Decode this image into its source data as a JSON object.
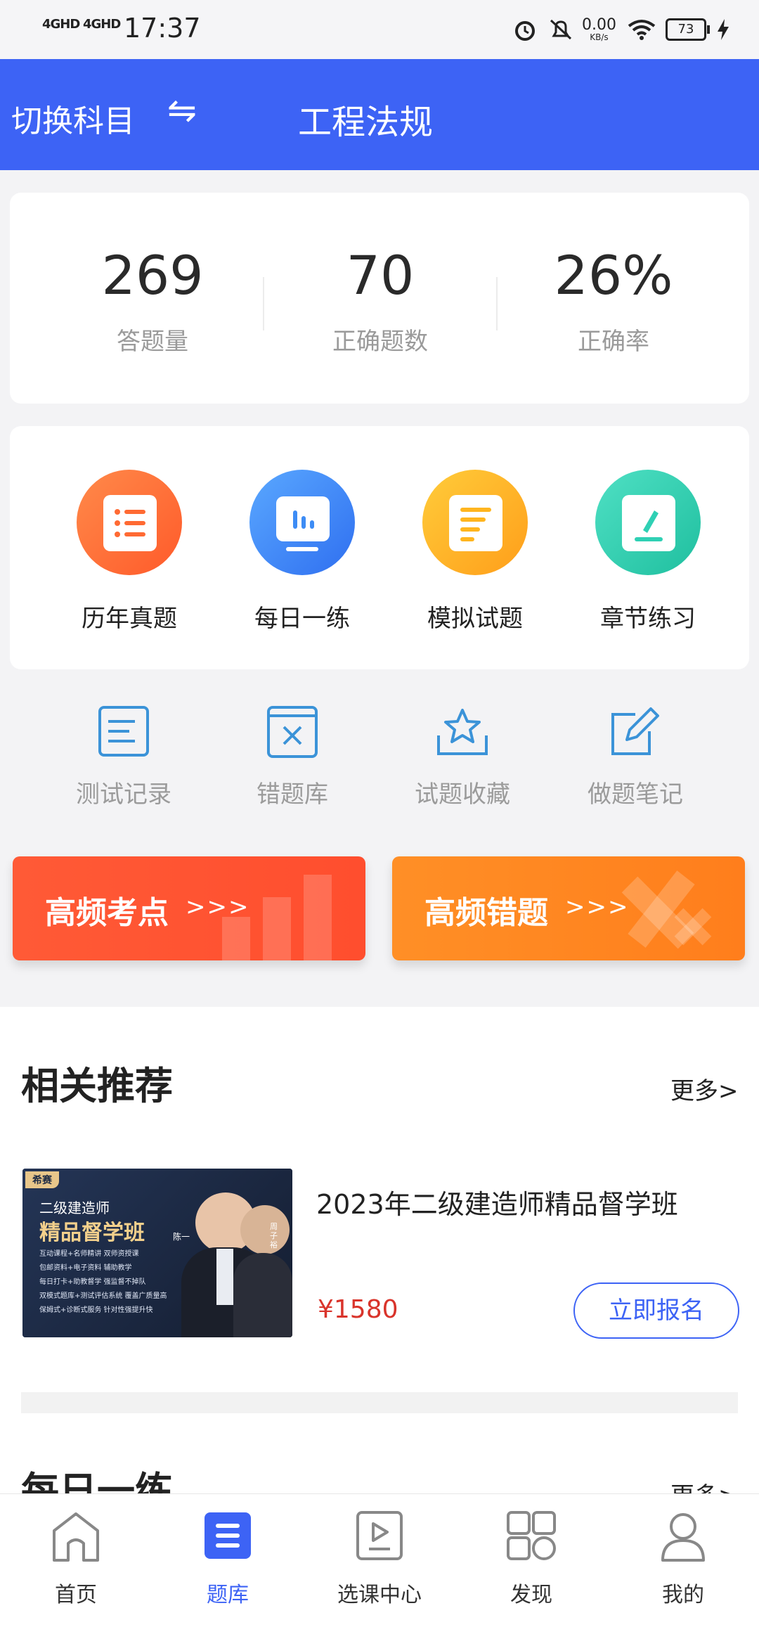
{
  "status_bar": {
    "signal1": "4GHD",
    "signal2": "4GHD",
    "time": "17:37",
    "net_speed": "0.00",
    "net_unit": "KB/s",
    "battery": "73"
  },
  "header": {
    "switch_label": "切换科目",
    "swap_icon": "⇋",
    "title": "工程法规"
  },
  "stats": [
    {
      "value": "269",
      "label": "答题量"
    },
    {
      "value": "70",
      "label": "正确题数"
    },
    {
      "value": "26%",
      "label": "正确率"
    }
  ],
  "features": [
    {
      "label": "历年真题",
      "icon": "list-icon",
      "color": "#ff6a33"
    },
    {
      "label": "每日一练",
      "icon": "chart-board-icon",
      "color": "#3d8cf5"
    },
    {
      "label": "模拟试题",
      "icon": "document-icon",
      "color": "#ffb51f"
    },
    {
      "label": "章节练习",
      "icon": "edit-icon",
      "color": "#2fd0b4"
    }
  ],
  "tools": [
    {
      "label": "测试记录",
      "icon": "record-icon"
    },
    {
      "label": "错题库",
      "icon": "wrong-book-icon"
    },
    {
      "label": "试题收藏",
      "icon": "star-tray-icon"
    },
    {
      "label": "做题笔记",
      "icon": "note-edit-icon"
    }
  ],
  "banners": [
    {
      "label": "高频考点",
      "arrows": ">>>",
      "color": "#ff5533"
    },
    {
      "label": "高频错题",
      "arrows": ">>>",
      "color": "#ff8a22"
    }
  ],
  "recommend": {
    "title": "相关推荐",
    "more": "更多>",
    "course": {
      "title": "2023年二级建造师精品督学班",
      "price": "¥1580",
      "enroll": "立即报名",
      "image_brand": "希赛",
      "image_subtitle": "二级建造师",
      "image_title": "精品督学班",
      "image_teacher1": "陈一",
      "image_teacher2": "周子裕",
      "image_features": [
        "互动课程+名师精讲  双师资授课",
        "包邮资料+电子资料  辅助教学",
        "每日打卡+助教督学  强监督不掉队",
        "双模式题库+测试评估系统  覆盖广质量高",
        "保姆式+诊断式服务  针对性强提升快"
      ]
    }
  },
  "daily": {
    "title": "每日一练",
    "more": "更多>"
  },
  "bottom_nav": [
    {
      "label": "首页",
      "active": false
    },
    {
      "label": "题库",
      "active": true
    },
    {
      "label": "选课中心",
      "active": false
    },
    {
      "label": "发现",
      "active": false
    },
    {
      "label": "我的",
      "active": false
    }
  ],
  "colors": {
    "primary": "#3d63f5",
    "price": "#d9342b"
  }
}
